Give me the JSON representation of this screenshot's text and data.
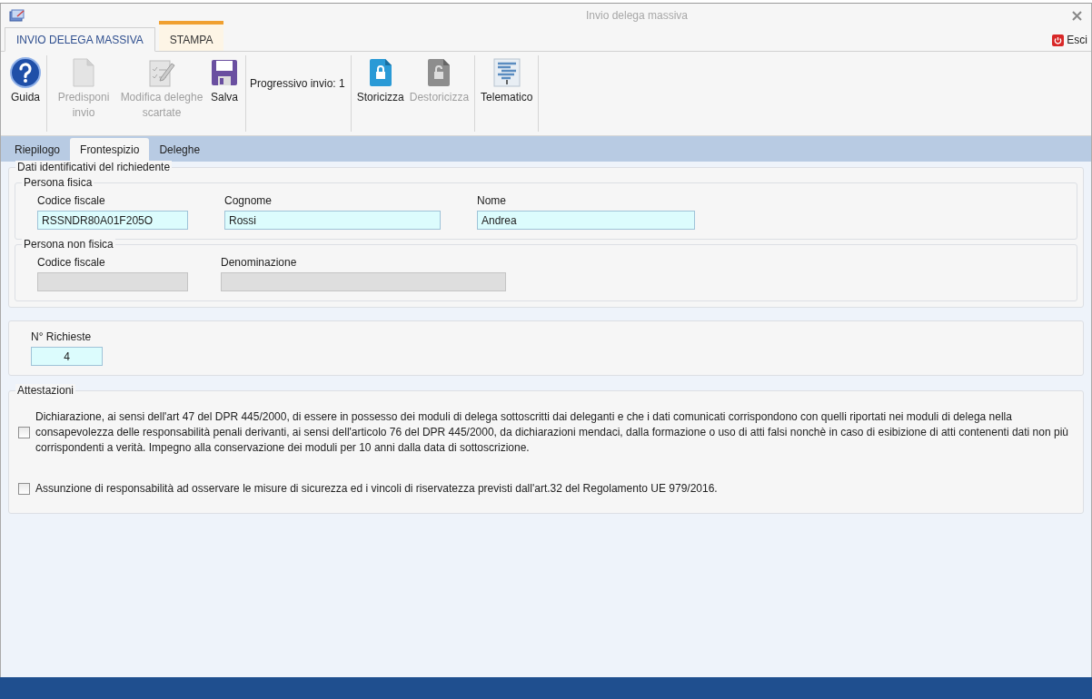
{
  "window": {
    "title": "Invio delega massiva"
  },
  "ribbon_tabs": [
    {
      "label": "INVIO DELEGA MASSIVA",
      "selected": true
    },
    {
      "label": "STAMPA",
      "selected": false
    }
  ],
  "exit_button": {
    "label": "Esci"
  },
  "toolbar": {
    "groups": [
      [
        {
          "kind": "button",
          "label": "Guida",
          "disabled": false
        }
      ],
      [
        {
          "kind": "button",
          "label": "Predisponi invio",
          "disabled": true
        },
        {
          "kind": "button",
          "label": "Modifica deleghe scartate",
          "disabled": true
        },
        {
          "kind": "button",
          "label": "Salva",
          "disabled": false
        }
      ],
      [
        {
          "kind": "label",
          "label": "Progressivo invio: 1"
        }
      ],
      [
        {
          "kind": "button",
          "label": "Storicizza",
          "disabled": false
        },
        {
          "kind": "button",
          "label": "Destoricizza",
          "disabled": true
        }
      ],
      [
        {
          "kind": "button",
          "label": "Telematico",
          "disabled": false
        }
      ]
    ]
  },
  "tabs": [
    {
      "label": "Riepilogo",
      "selected": false
    },
    {
      "label": "Frontespizio",
      "selected": true
    },
    {
      "label": "Deleghe",
      "selected": false
    }
  ],
  "richiedente": {
    "title": "Dati identificativi del richiedente",
    "sections": [
      {
        "title": "Persona fisica",
        "fields": [
          {
            "label": "Codice fiscale",
            "value": "RSSNDR80A01F205O",
            "disabled": false
          },
          {
            "label": "Cognome",
            "value": "Rossi",
            "disabled": false
          },
          {
            "label": "Nome",
            "value": "Andrea",
            "disabled": false
          }
        ]
      },
      {
        "title": "Persona non fisica",
        "fields": [
          {
            "label": "Codice fiscale",
            "disabled": true
          },
          {
            "label": "Denominazione",
            "disabled": true
          }
        ]
      }
    ]
  },
  "richieste": {
    "label": "N° Richieste",
    "value": "4"
  },
  "attestazioni": {
    "title": "Attestazioni",
    "items": [
      {
        "text": "Dichiarazione, ai sensi dell'art 47 del DPR 445/2000, di essere in possesso dei moduli di delega sottoscritti dai deleganti e che i dati comunicati corrispondono con quelli riportati nei moduli di delega nella consapevolezza delle responsabilità penali derivanti, ai sensi dell'articolo 76 del DPR 445/2000, da dichiarazioni mendaci, dalla formazione o uso di atti falsi nonchè in caso di esibizione di atti contenenti dati non più corrispondenti a verità. Impegno alla conservazione dei moduli per 10 anni dalla data di sottoscrizione.",
        "checked": false
      },
      {
        "text": "Assunzione di responsabilità ad osservare le misure di sicurezza ed i vincoli di riservatezza previsti dall'art.32 del Regolamento UE 979/2016.",
        "checked": false
      }
    ]
  }
}
